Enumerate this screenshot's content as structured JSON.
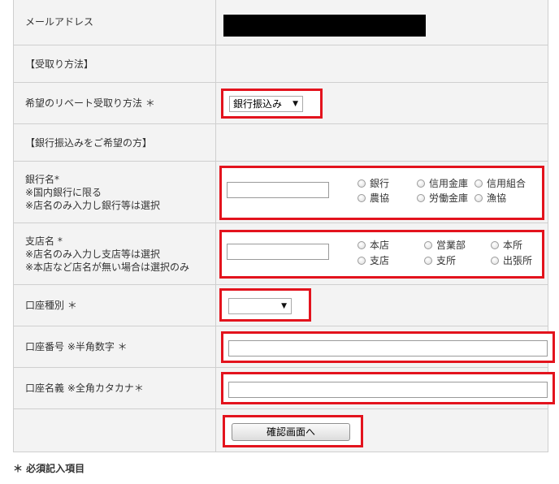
{
  "rows": {
    "email": {
      "label": "メールアドレス"
    },
    "receive_method_header": {
      "label": "【受取り方法】"
    },
    "rebate_method": {
      "label": "希望のリベート受取り方法 ＊",
      "selected": "銀行振込み"
    },
    "bank_transfer_header": {
      "label": "【銀行振込みをご希望の方】"
    },
    "bank_name": {
      "label_lines": [
        "銀行名*",
        "※国内銀行に限る",
        "※店名のみ入力し銀行等は選択"
      ],
      "options": [
        "銀行",
        "信用金庫",
        "信用組合",
        "農協",
        "労働金庫",
        "漁協"
      ]
    },
    "branch_name": {
      "label_lines": [
        "支店名 *",
        "※店名のみ入力し支店等は選択",
        "※本店など店名が無い場合は選択のみ"
      ],
      "options": [
        "本店",
        "営業部",
        "本所",
        "支店",
        "支所",
        "出張所"
      ]
    },
    "account_type": {
      "label": "口座種別 ＊",
      "selected": ""
    },
    "account_number": {
      "label": "口座番号 ※半角数字 ＊"
    },
    "account_name": {
      "label": "口座名義 ※全角カタカナ＊"
    },
    "confirm": {
      "button_label": "確認画面へ"
    }
  },
  "required_note": "＊ 必須記入項目",
  "colors": {
    "highlight": "#e3131d",
    "label_bg": "#f3f3f3",
    "border": "#cfcfcf"
  },
  "icons": {
    "dropdown": "chevron-down-icon"
  }
}
